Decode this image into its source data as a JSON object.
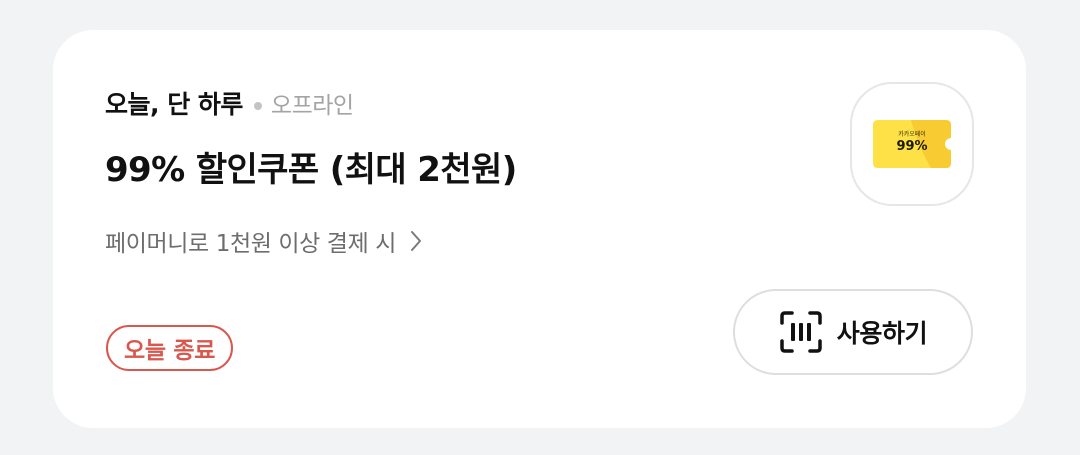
{
  "coupon_card": {
    "tagline": "오늘, 단 하루",
    "channel": "오프라인",
    "title": "99% 할인쿠폰 (최대 2천원)",
    "condition": "페이머니로 1천원 이상 결제 시",
    "status_badge": "오늘 종료",
    "thumbnail": {
      "brand": "카카오페이",
      "value": "99%"
    },
    "use_button_label": "사용하기",
    "icons": {
      "condition_arrow": "chevron-right-icon",
      "use_button": "barcode-scan-icon"
    }
  },
  "colors": {
    "page_background": "#f2f3f5",
    "card_background": "#ffffff",
    "badge_red": "#d9574d",
    "coupon_yellow": "#fde147"
  }
}
